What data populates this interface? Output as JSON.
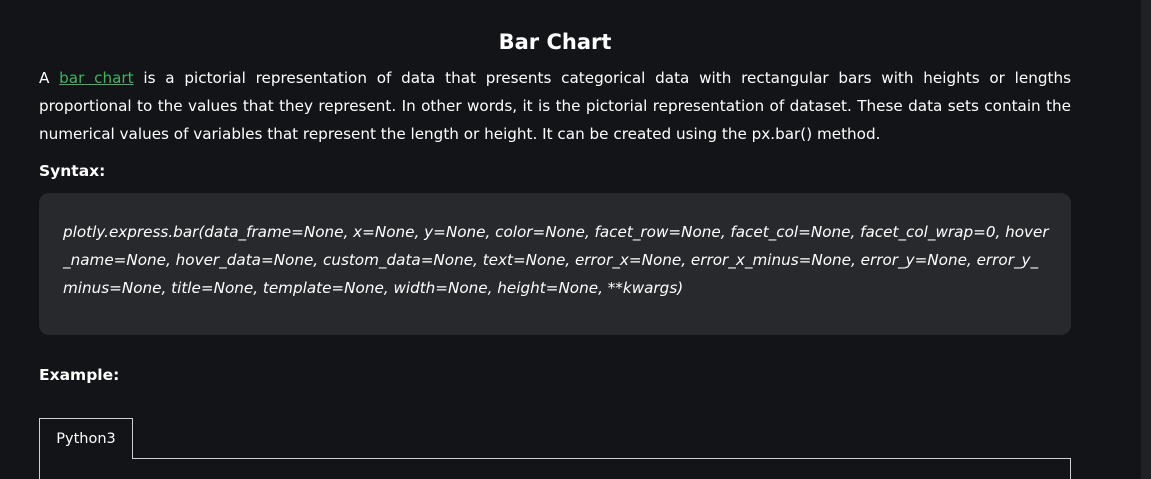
{
  "article": {
    "title": "Bar Chart",
    "intro": {
      "prefix": "A ",
      "link_text": "bar chart",
      "suffix": " is a pictorial representation of data that presents categorical data with rectangular bars with heights or lengths proportional to the values that they represent. In other words, it is the pictorial representation of dataset. These data sets contain the numerical values of variables that represent the length or height. It can be created using the px.bar() method."
    },
    "syntax_heading": "Syntax:",
    "syntax_code": "plotly.express.bar(data_frame=None, x=None, y=None, color=None, facet_row=None, facet_col=None, facet_col_wrap=0, hover_name=None, hover_data=None, custom_data=None, text=None, error_x=None, error_x_minus=None, error_y=None, error_y_minus=None, title=None, template=None, width=None, height=None, **kwargs)",
    "example_heading": "Example:",
    "tabs": [
      {
        "label": "Python3"
      }
    ]
  },
  "colors": {
    "background": "#131417",
    "code_background": "#28292c",
    "link": "#3bb75e",
    "text": "#ffffff",
    "tab_border": "#d0d0d0"
  }
}
